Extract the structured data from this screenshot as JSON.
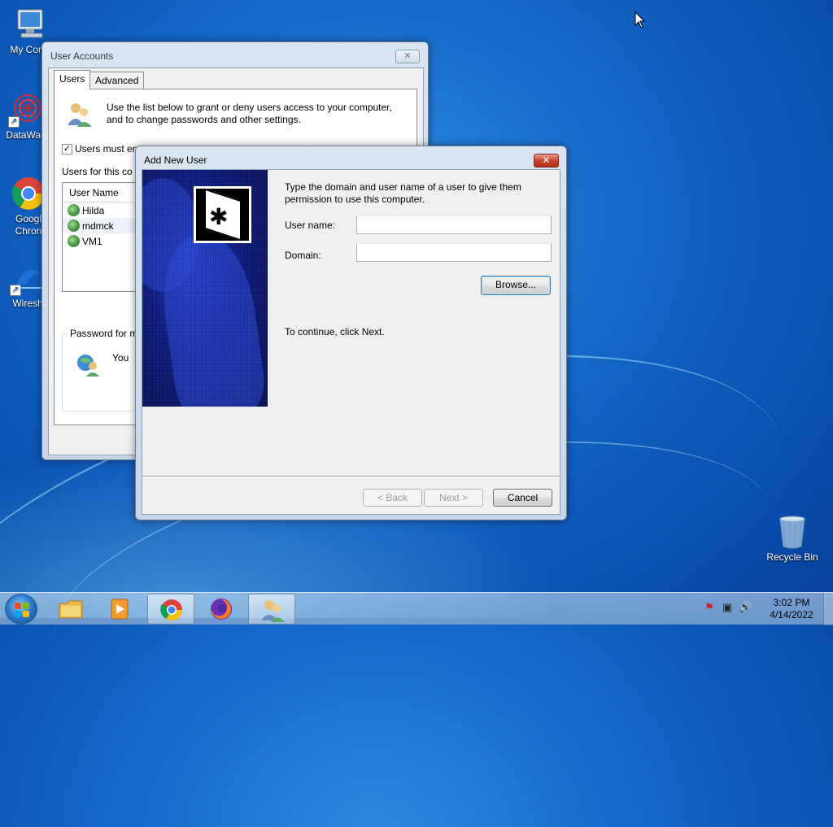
{
  "desktop": {
    "icons": [
      {
        "label": "My Comp",
        "icon": "computer-icon"
      },
      {
        "label": "DataWag",
        "icon": "datawagon-icon"
      },
      {
        "label": "Googl",
        "label2": "Chron",
        "icon": "chrome-icon"
      },
      {
        "label": "Wiresh",
        "icon": "wireshark-icon"
      },
      {
        "label": "Recycle Bin",
        "icon": "recycle-bin-icon"
      }
    ]
  },
  "user_accounts": {
    "title": "User Accounts",
    "close_label": "✕",
    "tabs": [
      {
        "label": "Users",
        "active": true
      },
      {
        "label": "Advanced",
        "active": false
      }
    ],
    "intro_line1": "Use the list below to grant or deny users access to your computer,",
    "intro_line2": "and to change passwords and other settings.",
    "checkbox_label": "Users must en",
    "checkbox_checked": true,
    "checkbox_mark": "✓",
    "users_for_label": "Users for this co",
    "list_header": "User Name",
    "users": [
      "Hilda",
      "mdmck",
      "VM1"
    ],
    "password_group_label": "Password for m",
    "password_text": "You"
  },
  "add_new_user": {
    "title": "Add New User",
    "close_label": "✕",
    "instruction_line1": "Type the domain and user name of a user to give them",
    "instruction_line2": "permission to use this computer.",
    "username_label": "User name:",
    "username_value": "",
    "domain_label": "Domain:",
    "domain_value": "",
    "browse_label": "Browse...",
    "continue_text": "To continue, click Next.",
    "back_label": "< Back",
    "next_label": "Next >",
    "cancel_label": "Cancel",
    "logo_glyph": "✱"
  },
  "taskbar": {
    "pinned": [
      {
        "name": "windows-explorer",
        "icon": "folder-icon",
        "active": false
      },
      {
        "name": "media-player",
        "icon": "media-player-icon",
        "active": false
      },
      {
        "name": "chrome",
        "icon": "chrome-icon",
        "active": true
      },
      {
        "name": "firefox",
        "icon": "firefox-icon",
        "active": false
      },
      {
        "name": "user-accounts",
        "icon": "user-accounts-icon",
        "active": true
      }
    ],
    "tray_icons": [
      "action-center-icon",
      "network-icon",
      "volume-icon"
    ],
    "tray_glyphs": [
      "⚑",
      "▣",
      "🔊"
    ],
    "time": "3:02 PM",
    "date": "4/14/2022"
  }
}
